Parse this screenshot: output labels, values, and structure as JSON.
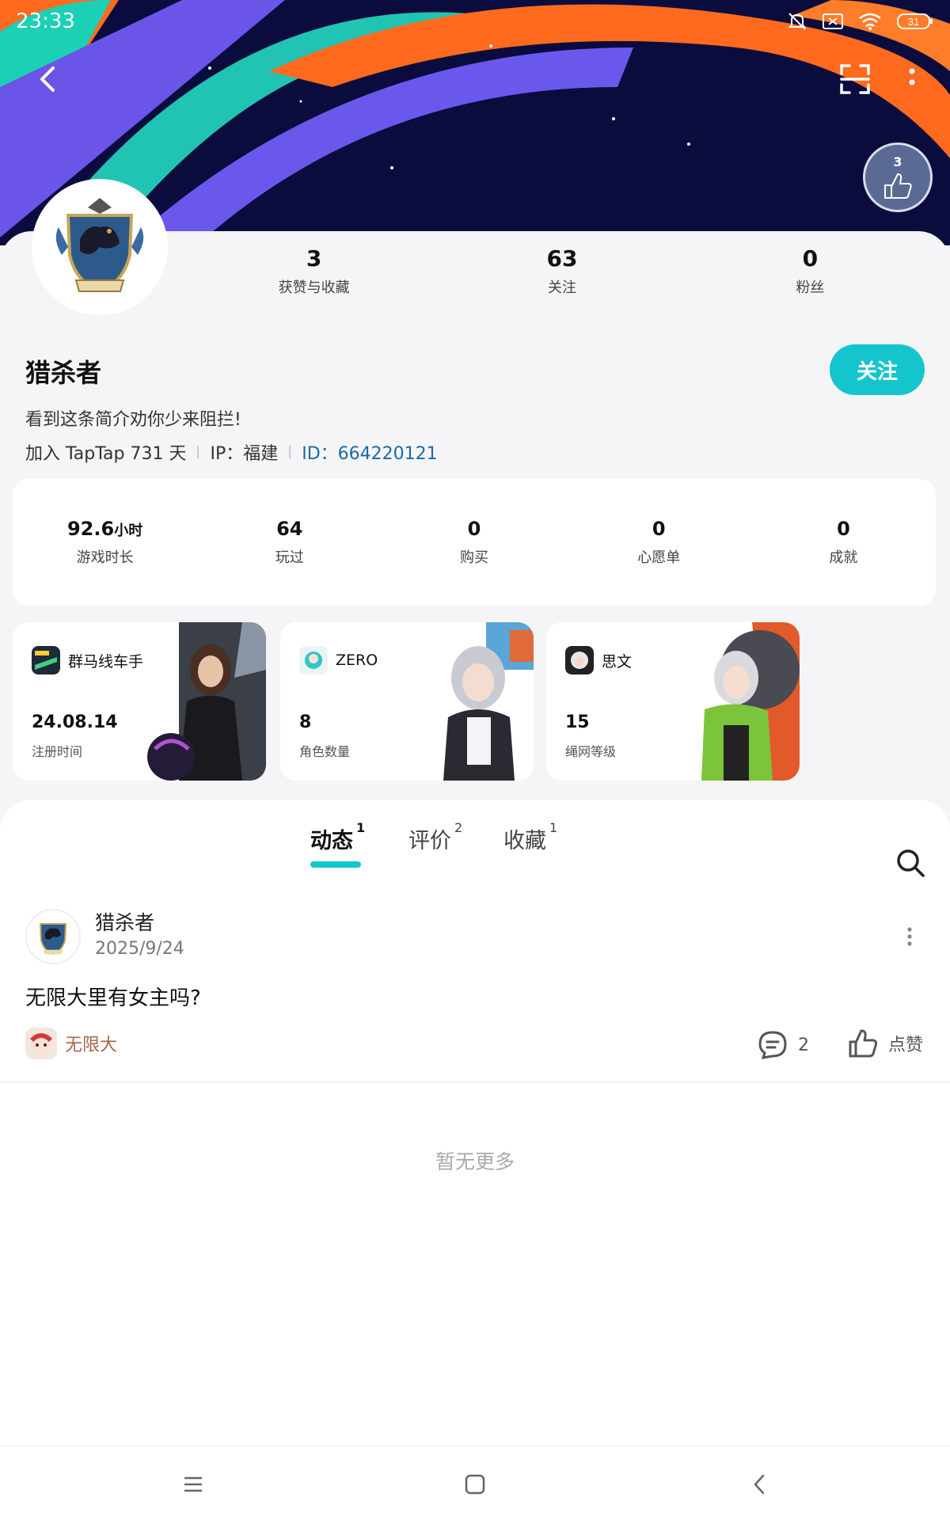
{
  "status_bar": {
    "time": "23:33",
    "battery": "31"
  },
  "profile": {
    "name": "猎杀者",
    "bio": "看到这条简介劝你少来阻拦!",
    "join": "加入 TapTap 731 天",
    "ip": "IP：福建",
    "id": "ID：664220121",
    "follow_label": "关注",
    "medal_count": "3",
    "stats": [
      {
        "value": "3",
        "label": "获赞与收藏"
      },
      {
        "value": "63",
        "label": "关注"
      },
      {
        "value": "0",
        "label": "粉丝"
      }
    ]
  },
  "game_stats": [
    {
      "value": "92.6",
      "unit": "小时",
      "label": "游戏时长"
    },
    {
      "value": "64",
      "unit": "",
      "label": "玩过"
    },
    {
      "value": "0",
      "unit": "",
      "label": "购买"
    },
    {
      "value": "0",
      "unit": "",
      "label": "心愿单"
    },
    {
      "value": "0",
      "unit": "",
      "label": "成就"
    }
  ],
  "game_cards": [
    {
      "name": "群马线车手",
      "value": "24.08.14",
      "label": "注册时间"
    },
    {
      "name": "ZERO",
      "value": "8",
      "label": "角色数量"
    },
    {
      "name": "思文",
      "value": "15",
      "label": "绳网等级"
    }
  ],
  "tabs": [
    {
      "label": "动态",
      "count": "1"
    },
    {
      "label": "评价",
      "count": "2"
    },
    {
      "label": "收藏",
      "count": "1"
    }
  ],
  "post": {
    "author": "猎杀者",
    "date": "2025/9/24",
    "text": "无限大里有女主吗?",
    "game": "无限大",
    "comments": "2",
    "like_label": "点赞"
  },
  "no_more": "暂无更多",
  "colors": {
    "accent": "#15c5ce",
    "banner_bg": "#0a0b3c",
    "id_link": "#1a6aa8"
  }
}
